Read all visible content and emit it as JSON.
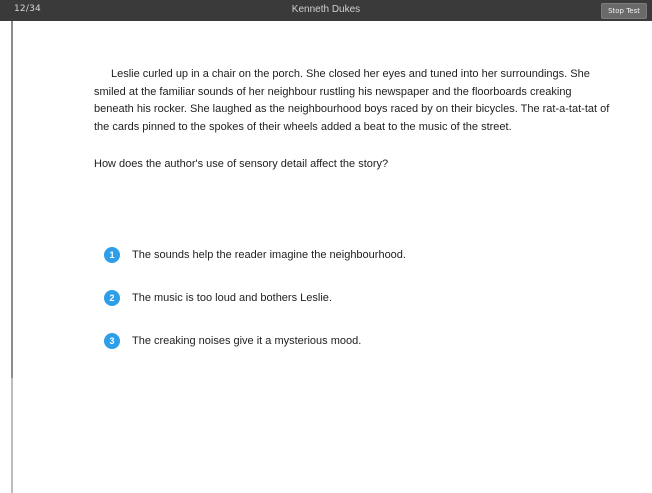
{
  "header": {
    "counter": "12/34",
    "student_name": "Kenneth Dukes",
    "stop_label": "Stop Test"
  },
  "passage": "Leslie curled up in a chair on the porch. She closed her eyes and tuned into her surroundings. She smiled at the familiar sounds of her neighbour rustling his newspaper and the floorboards creaking beneath his rocker. She laughed as the neighbourhood boys raced by on their bicycles. The rat-a-tat-tat of the cards pinned to the spokes of their wheels added a beat to the music of the street.",
  "question": "How does the author's use of sensory detail affect the story?",
  "choices": [
    {
      "number": "1",
      "text": "The sounds help the reader imagine the neighbourhood."
    },
    {
      "number": "2",
      "text": "The music is too loud and bothers Leslie."
    },
    {
      "number": "3",
      "text": "The creaking noises give it a mysterious mood."
    }
  ],
  "colors": {
    "topbar": "#3a3a3a",
    "choice_bubble": "#2e9ee8"
  }
}
